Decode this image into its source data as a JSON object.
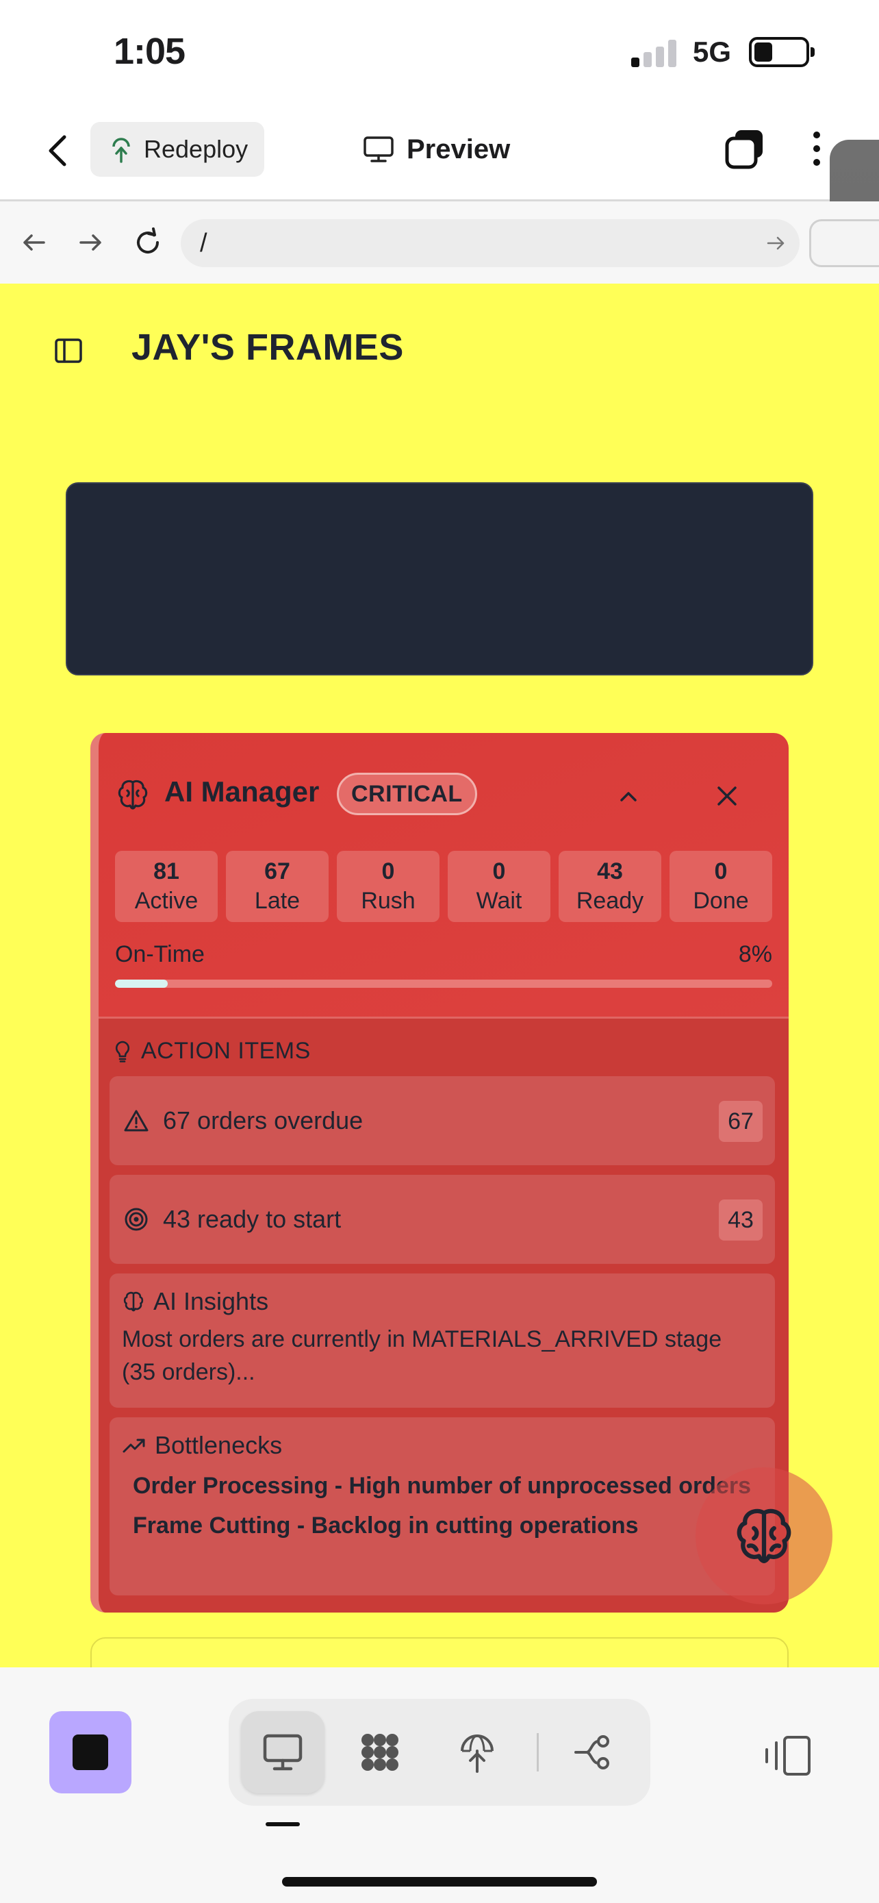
{
  "status_bar": {
    "time": "1:05",
    "network": "5G"
  },
  "top_bar": {
    "redeploy_label": "Redeploy",
    "preview_label": "Preview"
  },
  "url_bar": {
    "url": "/"
  },
  "app": {
    "brand": "JAY'S FRAMES"
  },
  "ai_manager": {
    "title": "AI Manager",
    "severity": "CRITICAL",
    "stats": [
      {
        "value": "81",
        "label": "Active"
      },
      {
        "value": "67",
        "label": "Late"
      },
      {
        "value": "0",
        "label": "Rush"
      },
      {
        "value": "0",
        "label": "Wait"
      },
      {
        "value": "43",
        "label": "Ready"
      },
      {
        "value": "0",
        "label": "Done"
      }
    ],
    "on_time": {
      "label": "On-Time",
      "value": "8%",
      "fraction": 0.08
    },
    "action_items_heading": "ACTION ITEMS",
    "action_items": [
      {
        "text": "67 orders overdue",
        "count": "67",
        "icon": "warning-icon"
      },
      {
        "text": "43 ready to start",
        "count": "43",
        "icon": "target-icon"
      }
    ],
    "insights": {
      "heading": "AI Insights",
      "text": "Most orders are currently in MATERIALS_ARRIVED stage (35 orders)..."
    },
    "bottlenecks": {
      "heading": "Bottlenecks",
      "items": [
        "Order Processing - High number of unprocessed orders",
        "Frame Cutting - Backlog in cutting operations"
      ]
    }
  },
  "colors": {
    "app_background": "#ffff57",
    "critical_card": "#d93b38",
    "banner": "#212837",
    "stop_button": "#b9a7ff"
  }
}
